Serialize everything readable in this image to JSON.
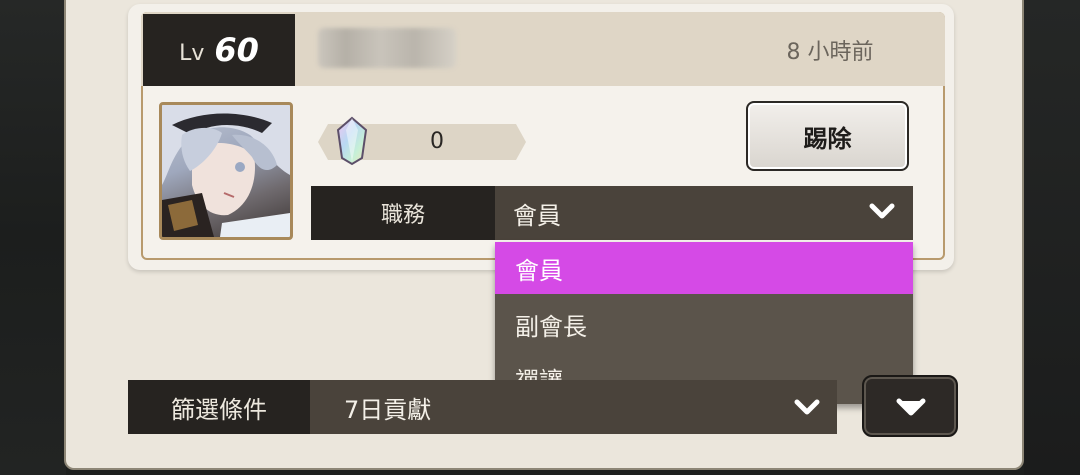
{
  "member": {
    "level_label": "Lv",
    "level": "60",
    "last_seen": "8 小時前",
    "gem_count": "0",
    "kick_label": "踢除"
  },
  "role": {
    "label": "職務",
    "selected": "會員",
    "options": [
      "會員",
      "副會長",
      "禪讓"
    ]
  },
  "filter": {
    "label": "篩選條件",
    "selected": "7日貢獻"
  },
  "colors": {
    "highlight": "#d54ae6",
    "dark_label": "#262320",
    "select_bg": "#4a433b",
    "frame_gold": "#b89a6d"
  },
  "icons": [
    "gem-icon",
    "chevron-down-icon",
    "avatar"
  ]
}
